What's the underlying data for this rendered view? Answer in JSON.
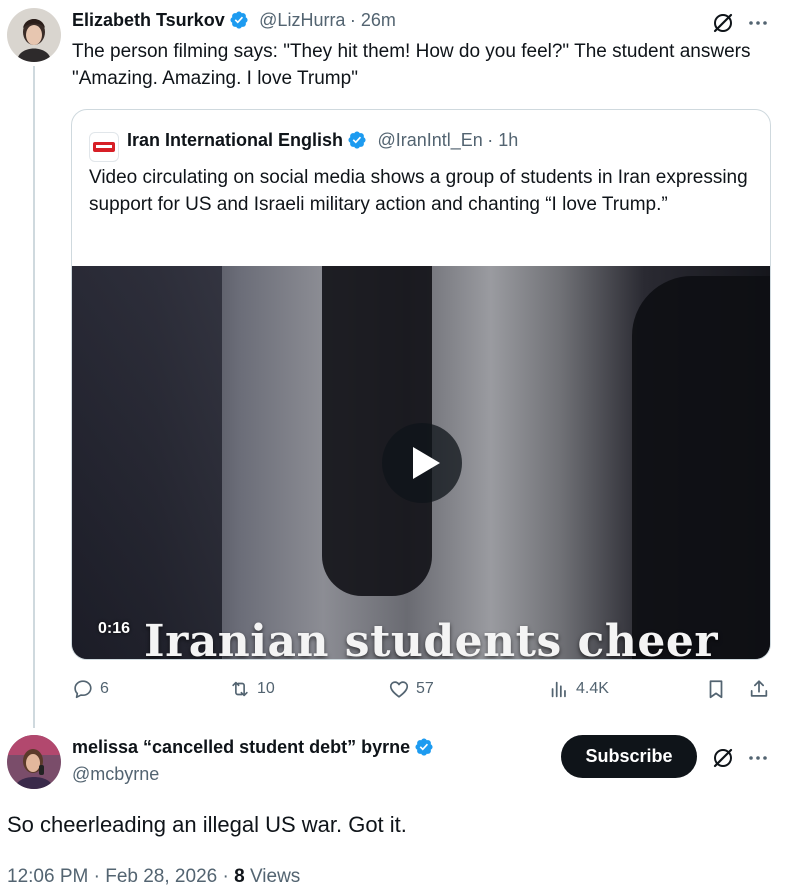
{
  "post": {
    "author_name": "Elizabeth Tsurkov",
    "author_handle": "@LizHurra",
    "age": "· 26m",
    "text": "The person filming says: \"They hit them! How do you feel?\" The student answers \"Amazing. Amazing. I love Trump\""
  },
  "quote": {
    "author_name": "Iran International English",
    "author_handle": "@IranIntl_En",
    "age": "· 1h",
    "text": "Video circulating on social media shows a group of students in Iran expressing support for US and Israeli military action and chanting “I love Trump.”",
    "video": {
      "duration": "0:16",
      "overlay_caption": "Iranian students cheer"
    }
  },
  "actions": {
    "replies": "6",
    "reposts": "10",
    "likes": "57",
    "views": "4.4K"
  },
  "reply": {
    "author_name": "melissa “cancelled student debt” byrne",
    "author_handle": "@mcbyrne",
    "subscribe_label": "Subscribe",
    "text": "So cheerleading an illegal US war. Got it.",
    "time": "12:06 PM",
    "date": "Feb 28, 2026",
    "view_count": "8",
    "views_label": "Views"
  },
  "icons": {
    "more": "more-icon",
    "grok": "grok-icon",
    "verified": "verified-badge-icon",
    "reply": "reply-icon",
    "repost": "repost-icon",
    "like": "like-icon",
    "views": "views-icon",
    "bookmark": "bookmark-icon",
    "share": "share-icon"
  },
  "colors": {
    "verified": "#1d9bf0",
    "text_primary": "#0f1419",
    "text_secondary": "#536471",
    "border": "#cfd9de"
  }
}
